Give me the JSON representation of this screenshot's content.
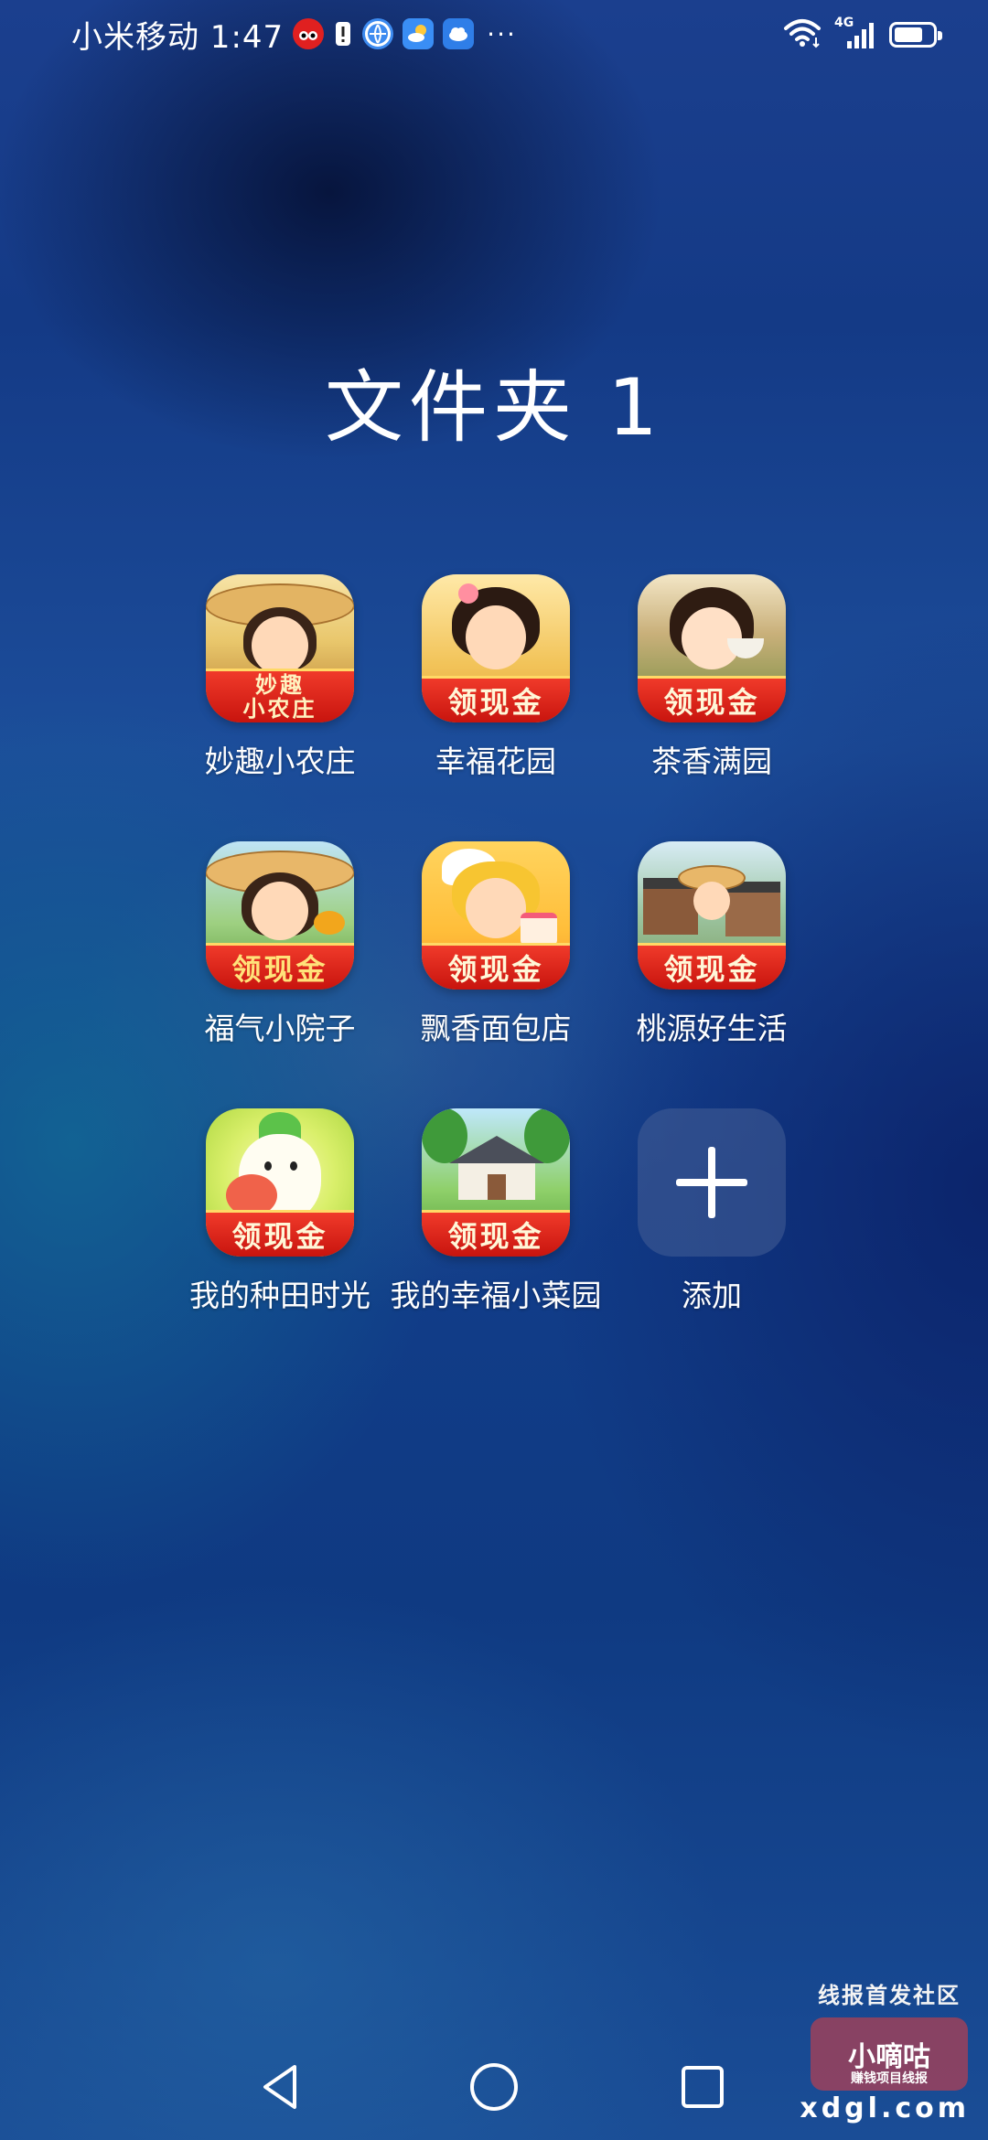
{
  "status_bar": {
    "carrier_time": "小米移动 1:47",
    "notification_icons": [
      "app-notification-icon",
      "alert-icon",
      "browser-icon",
      "weather-icon",
      "cloud-icon"
    ],
    "more": "···",
    "network_label": "4G",
    "battery_level": 0.75
  },
  "folder": {
    "title": "文件夹 1",
    "apps": [
      {
        "name": "妙趣小农庄",
        "badge": "妙趣\n小农庄"
      },
      {
        "name": "幸福花园",
        "badge": "领现金"
      },
      {
        "name": "茶香满园",
        "badge": "领现金"
      },
      {
        "name": "福气小院子",
        "badge": "领现金"
      },
      {
        "name": "飘香面包店",
        "badge": "领现金"
      },
      {
        "name": "桃源好生活",
        "badge": "领现金"
      },
      {
        "name": "我的种田时光",
        "badge": "领现金"
      },
      {
        "name": "我的幸福小菜园",
        "badge": "领现金"
      }
    ],
    "add_label": "添加"
  },
  "watermark": {
    "caption": "线报首发社区",
    "logo": "小嘀咕",
    "logo_sub": "赚钱项目线报",
    "site": "xdgl.com"
  },
  "colors": {
    "ribbon_red": "#d81a12",
    "ribbon_border": "#ffd966",
    "folder_add_bg": "#465f96"
  }
}
